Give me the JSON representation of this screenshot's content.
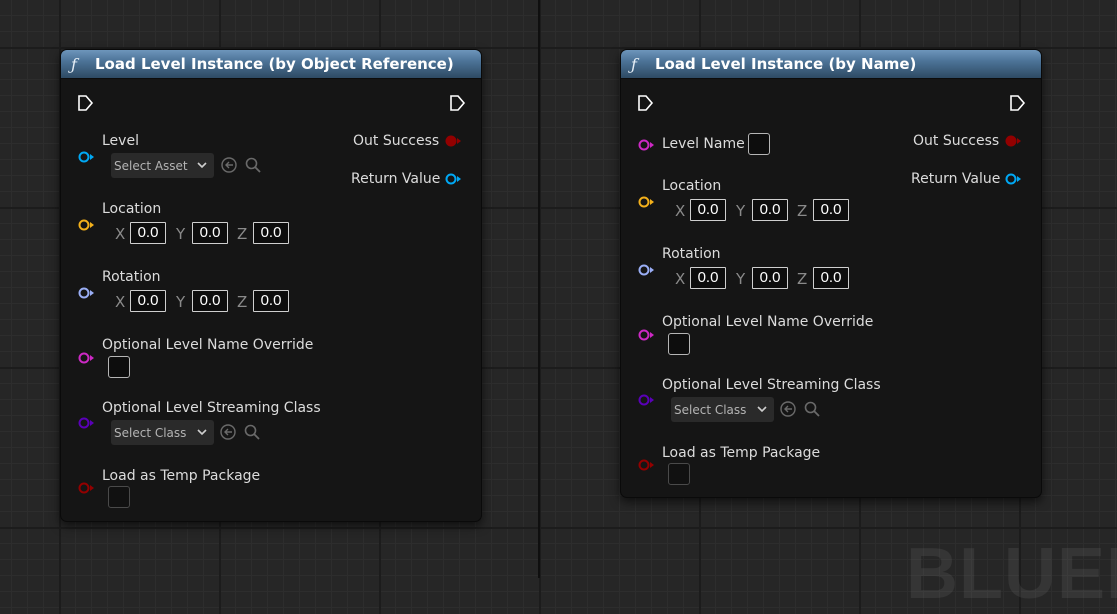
{
  "nodes": [
    {
      "title": "Load Level Instance (by Object Reference)",
      "exec_in": "exec-input-pin",
      "exec_out": "exec-output-pin",
      "level_label": "Level",
      "level_dropdown": "Select Asset",
      "location_label": "Location",
      "location": {
        "x": "0.0",
        "y": "0.0",
        "z": "0.0"
      },
      "rotation_label": "Rotation",
      "rotation": {
        "x": "0.0",
        "y": "0.0",
        "z": "0.0"
      },
      "name_override_label": "Optional Level Name Override",
      "streaming_class_label": "Optional Level Streaming Class",
      "streaming_class_dropdown": "Select Class",
      "temp_package_label": "Load as Temp Package",
      "out_success_label": "Out Success",
      "return_value_label": "Return Value"
    },
    {
      "title": "Load Level Instance (by Name)",
      "level_name_label": "Level Name",
      "location_label": "Location",
      "location": {
        "x": "0.0",
        "y": "0.0",
        "z": "0.0"
      },
      "rotation_label": "Rotation",
      "rotation": {
        "x": "0.0",
        "y": "0.0",
        "z": "0.0"
      },
      "name_override_label": "Optional Level Name Override",
      "streaming_class_label": "Optional Level Streaming Class",
      "streaming_class_dropdown": "Select Class",
      "temp_package_label": "Load as Temp Package",
      "out_success_label": "Out Success",
      "return_value_label": "Return Value"
    }
  ],
  "axis_labels": {
    "x": "X",
    "y": "Y",
    "z": "Z"
  },
  "function_icon": "ƒ",
  "watermark": "BLUEP",
  "pin_colors": {
    "object": "#00a8f4",
    "struct_vector": "#f3b01b",
    "struct_rotator": "#9aaef5",
    "name": "#cc29c4",
    "class": "#5a00b8",
    "bool": "#930000",
    "exec": "#ffffff"
  }
}
